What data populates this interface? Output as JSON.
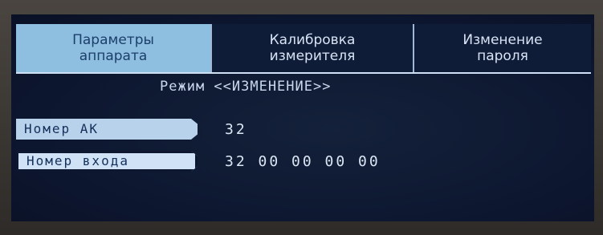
{
  "tabs": [
    {
      "label": "Параметры\nаппарата",
      "selected": true
    },
    {
      "label": "Калибровка\nизмерителя",
      "selected": false
    },
    {
      "label": "Изменение\nпароля",
      "selected": false
    }
  ],
  "mode_text": "Режим <<ИЗМЕНЕНИЕ>>",
  "fields": [
    {
      "label": "Номер АК",
      "value": "32"
    },
    {
      "label": "Номер входа",
      "value": "32 00 00 00 00"
    }
  ],
  "colors": {
    "screen_bg": "#0d1730",
    "selected_tab": "#8fbfe0",
    "label_bg": "#b9d2ec",
    "text": "#d7e4f4"
  }
}
